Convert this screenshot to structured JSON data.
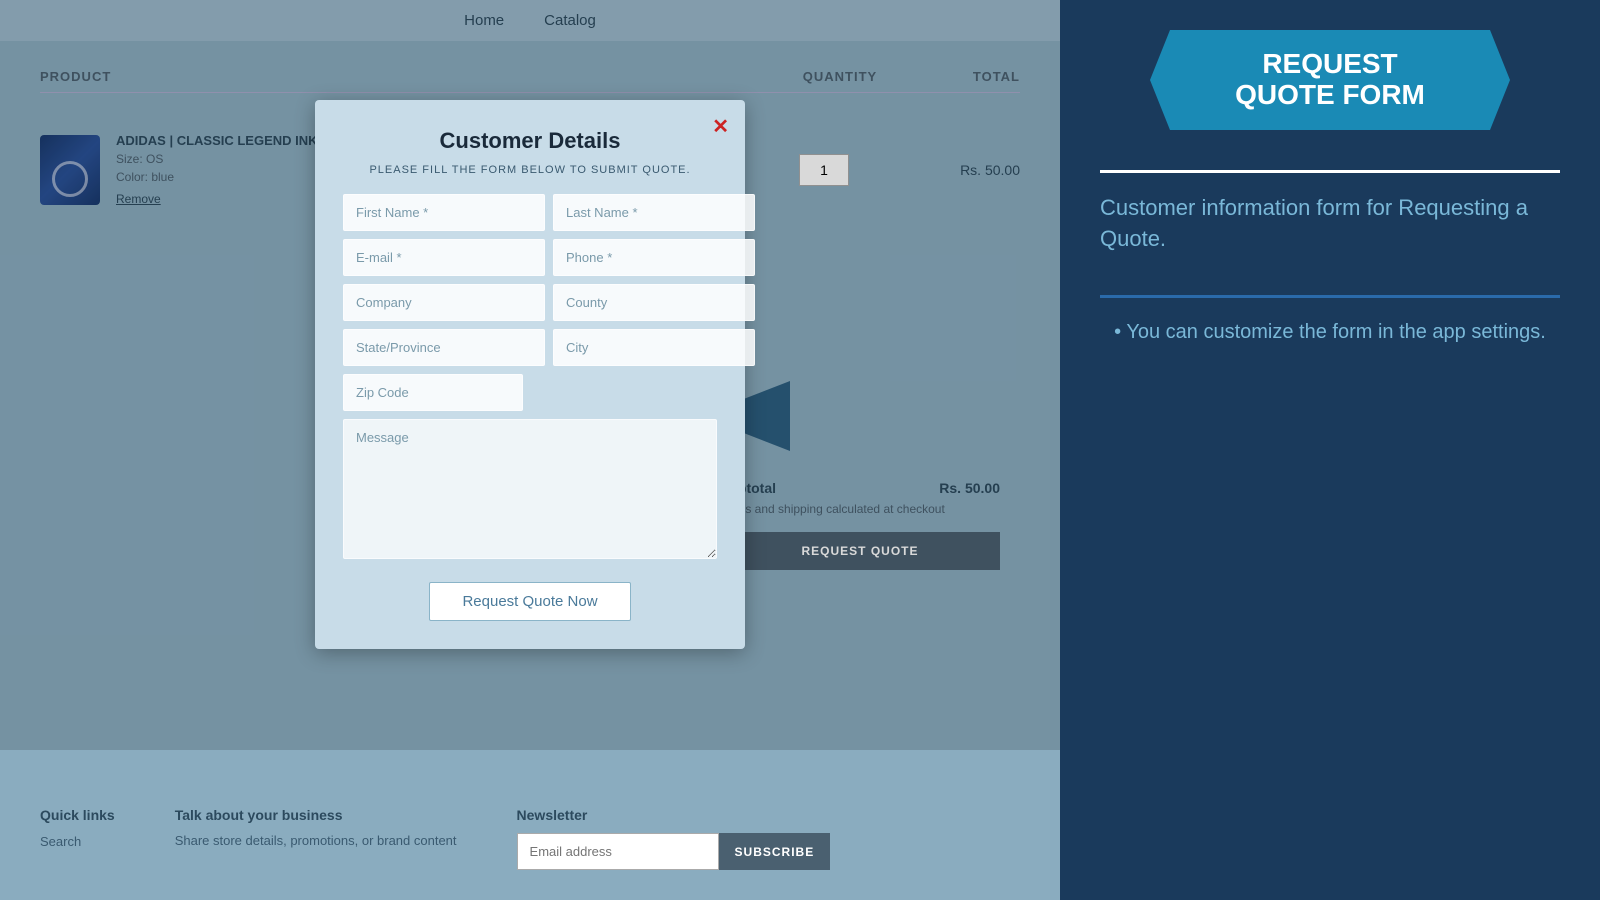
{
  "nav": {
    "items": [
      {
        "label": "Home"
      },
      {
        "label": "Catalog"
      }
    ]
  },
  "table": {
    "col_product": "PRODUCT",
    "col_quantity": "QUANTITY",
    "col_total": "TOTAL"
  },
  "product": {
    "name": "ADIDAS | CLASSIC LEGEND INK MULT",
    "size": "Size: OS",
    "color": "Color: blue",
    "remove_label": "Remove",
    "quantity": "1",
    "price": "Rs. 50.00"
  },
  "subtotal": {
    "label": "Subtotal",
    "amount": "Rs. 50.00",
    "tax_note": "Taxes and shipping calculated at checkout"
  },
  "request_quote_btn": "REQUEST QUOTE",
  "footer": {
    "quick_links": {
      "title": "Quick links",
      "search": "Search"
    },
    "business": {
      "title": "Talk about your business",
      "desc": "Share store details, promotions, or brand content"
    },
    "newsletter": {
      "title": "Newsletter",
      "placeholder": "Email address",
      "subscribe_btn": "SUBSCRIBE"
    }
  },
  "sidebar": {
    "banner_line1": "REQUEST",
    "banner_line2": "QUOTE FORM",
    "description": "Customer information form for Requesting a Quote.",
    "tip": "• You can customize the form in the app settings."
  },
  "modal": {
    "title": "Customer Details",
    "subtitle": "PLEASE FILL THE FORM BELOW TO SUBMIT QUOTE.",
    "close_label": "✕",
    "fields": {
      "first_name": "First Name *",
      "last_name": "Last Name *",
      "email": "E-mail *",
      "phone": "Phone *",
      "company": "Company",
      "county": "County",
      "state_province": "State/Province",
      "city": "City",
      "zip_code": "Zip Code",
      "message": "Message"
    },
    "submit_btn": "Request Quote Now"
  }
}
